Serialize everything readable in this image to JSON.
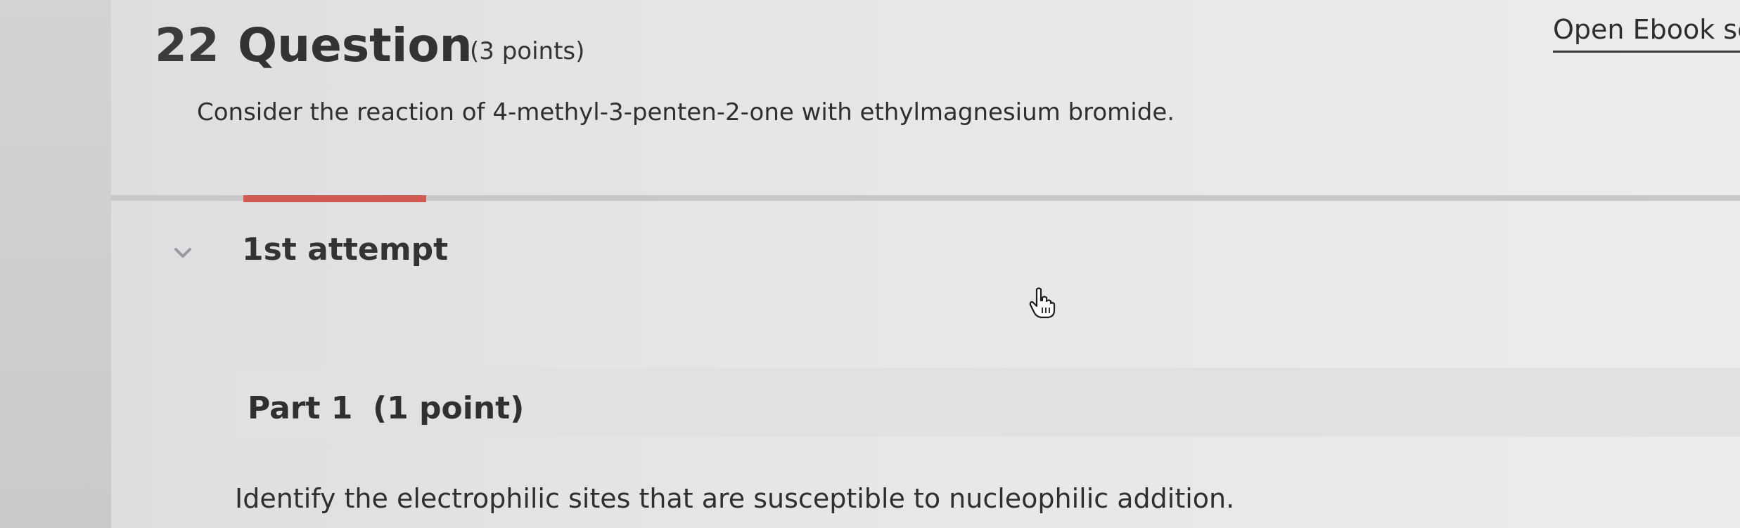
{
  "question": {
    "number": "22",
    "title": "Question",
    "points": "(3 points)",
    "prompt": "Consider the reaction of 4-methyl-3-penten-2-one with ethylmagnesium bromide."
  },
  "header": {
    "ebook_link": "Open Ebook se"
  },
  "attempt": {
    "label": "1st attempt",
    "toggle_icon": "chevron-down-icon"
  },
  "part": {
    "label": "Part 1",
    "points": "(1 point)",
    "instruction": "Identify the electrophilic sites that are susceptible to nucleophilic addition."
  },
  "colors": {
    "accent": "#d15a52",
    "text": "#2d2d30",
    "divider": "#c8c8ca"
  },
  "cursor": {
    "icon": "hand-pointer-icon"
  }
}
